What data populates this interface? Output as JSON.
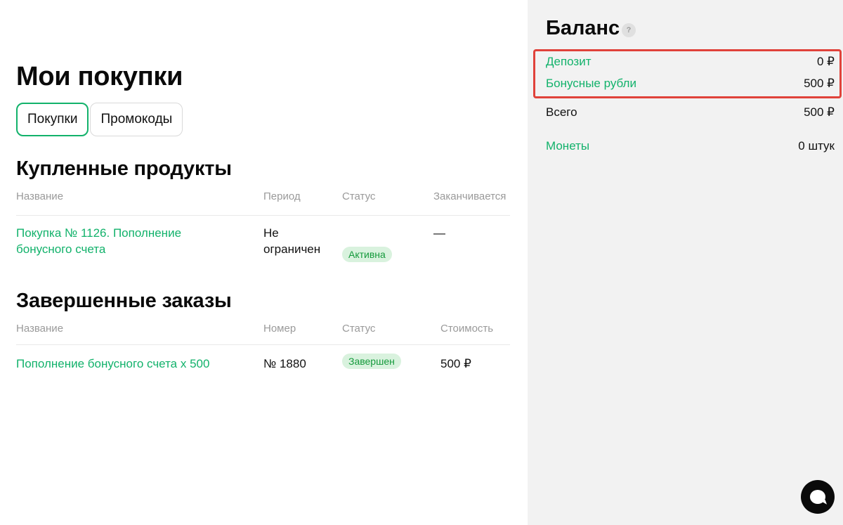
{
  "main": {
    "title": "Мои покупки",
    "tabs": [
      {
        "label": "Покупки",
        "active": true
      },
      {
        "label": "Промокоды",
        "active": false
      }
    ],
    "purchased": {
      "title": "Купленные продукты",
      "headers": [
        "Название",
        "Период",
        "Статус",
        "Заканчивается"
      ],
      "rows": [
        {
          "name_line1": "Покупка № 1126. Пополнение",
          "name_line2": "бонусного счета",
          "period_line1": "Не",
          "period_line2": "ограничен",
          "status": "Активна",
          "ends": "—"
        }
      ]
    },
    "completed": {
      "title": "Завершенные заказы",
      "headers": [
        "Название",
        "Номер",
        "Статус",
        "Стоимость"
      ],
      "rows": [
        {
          "name": "Пополнение бонусного счета х 500",
          "number": "№ 1880",
          "status": "Завершен",
          "cost": "500 ₽"
        }
      ]
    }
  },
  "balance": {
    "title": "Баланс",
    "help_icon": "?",
    "items": [
      {
        "label": "Депозит",
        "value": "0 ₽"
      },
      {
        "label": "Бонусные рубли",
        "value": "500 ₽"
      },
      {
        "label": "Всего",
        "value": "500 ₽"
      },
      {
        "label": "Монеты",
        "value": "0 штук"
      }
    ]
  },
  "colors": {
    "accent": "#12b26b",
    "highlight": "#e0423a",
    "panel_bg": "#f2f2f2"
  }
}
